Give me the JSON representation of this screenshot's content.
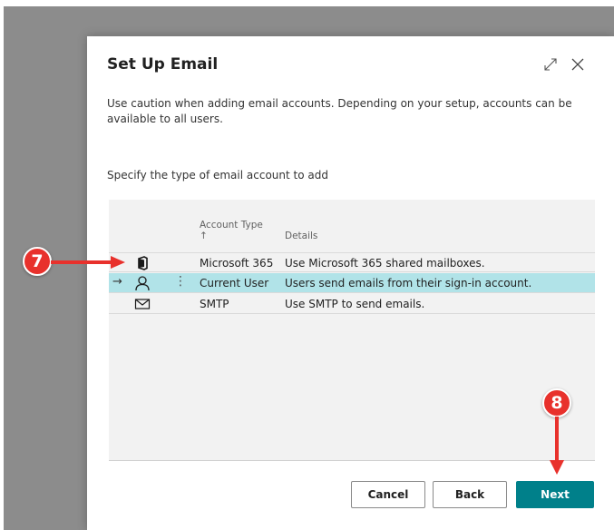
{
  "dialog": {
    "title": "Set Up Email",
    "caution_text": "Use caution when adding email accounts. Depending on your setup, accounts can be available to all users.",
    "instruction": "Specify the type of email account to add"
  },
  "grid": {
    "columns": [
      {
        "label": "Account Type ↑"
      },
      {
        "label": "Details"
      }
    ],
    "rows": [
      {
        "icon": "microsoft-365-icon",
        "type": "Microsoft 365",
        "details": "Use Microsoft 365 shared mailboxes.",
        "selected": false
      },
      {
        "icon": "user-icon",
        "type": "Current User",
        "details": "Users send emails from their sign-in account.",
        "selected": true
      },
      {
        "icon": "envelope-icon",
        "type": "SMTP",
        "details": "Use SMTP to send emails.",
        "selected": false
      }
    ],
    "row_arrow": "→",
    "row_menu": "⋮"
  },
  "buttons": {
    "cancel": "Cancel",
    "back": "Back",
    "next": "Next"
  },
  "annotations": {
    "step7": "7",
    "step8": "8"
  },
  "colors": {
    "accent": "#00808a",
    "selected_row": "#b1e3e8",
    "badge": "#e8312c"
  }
}
